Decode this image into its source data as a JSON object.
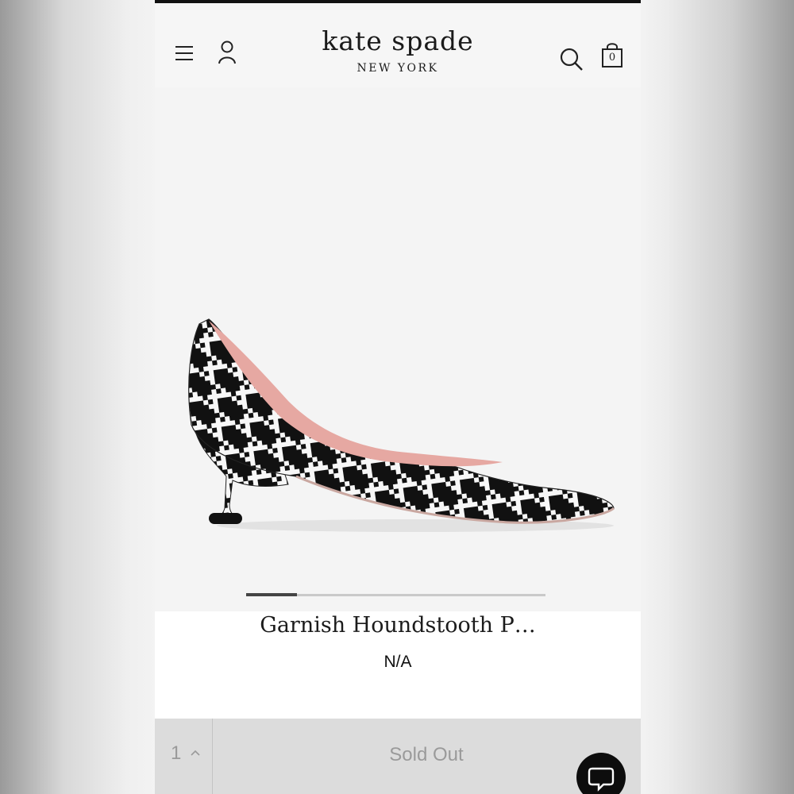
{
  "header": {
    "brand_name": "kate spade",
    "brand_sub": "NEW YORK",
    "bag_count": "0",
    "icons": [
      "menu-icon",
      "account-icon",
      "search-icon",
      "shopping-bag-icon"
    ]
  },
  "product": {
    "title": "Garnish Houndstooth P…",
    "price": "N/A",
    "image": "houndstooth-pump-shoe"
  },
  "carousel": {
    "current_index": 1,
    "progress": 0.17
  },
  "purchase": {
    "quantity": "1",
    "button_label": "Sold Out"
  },
  "chat": {
    "icon": "chat-bubble-icon"
  },
  "colors": {
    "text": "#1b1b1b",
    "disabled_text": "#9a9a9a",
    "action_bar": "#dcdcdc",
    "chat_button": "#0d0d0d",
    "shoe_lining": "#e6a8a2"
  }
}
